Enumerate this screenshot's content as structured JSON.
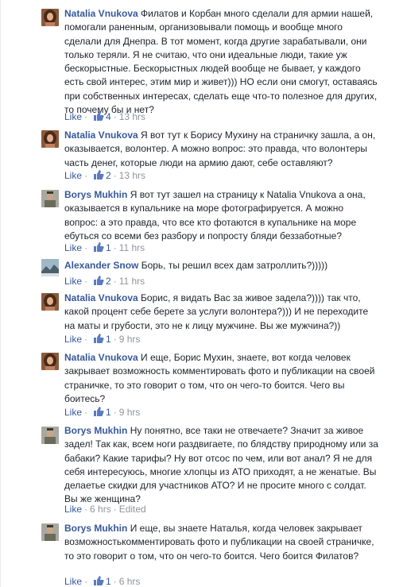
{
  "comments": [
    {
      "author": "Natalia Vnukova",
      "text": "Филатов и Корбан много сделали для армии нашей, помогали раненным, организовывали помощь и вообще много сделали для Днепра. В тот момент, когда другие зарабатывали, они только теряли. Я не считаю, что они идеальные люди, такие уж бескорыстные. Бескорыстных людей вообще не бывает, у каждого есть свой интерес, этим мир и живет))) НО если они смогут, оставаясь при собственных интересах, сделать еще что-то полезное для других, то почему бы и нет?",
      "like_label": "Like",
      "likes": "4",
      "time": "13 hrs",
      "avatar": "female-avatar"
    },
    {
      "author": "Natalia Vnukova",
      "text": "Я вот тут к Борису Мухину на страничку зашла, а он, оказывается, волонтер. А можно вопрос: это правда, что волонтеры часть денег, которые люди на армию дают, себе оставляют?",
      "like_label": "Like",
      "likes": "2",
      "time": "13 hrs",
      "avatar": "female-avatar"
    },
    {
      "author": "Borys Mukhin",
      "text": "Я вот тут зашел на страницу к Natalia Vnukova а она, оказывается в купальнике на море фотографируется. А можно вопрос: а это правда, что все кто фотаются в купальнике на море ебуться со всеми без разбору и попросту бляди беззаботные?",
      "like_label": "Like",
      "likes": "1",
      "time": "11 hrs",
      "avatar": "male-avatar"
    },
    {
      "author": "Alexander Snow",
      "text": "Борь, ты решил всех дам затроллить?)))))",
      "like_label": "Like",
      "likes": "2",
      "time": "11 hrs",
      "avatar": "landscape-avatar"
    },
    {
      "author": "Natalia Vnukova",
      "text": "Борис, я видать Вас за живое задела?)))) так что, какой процент себе берете за услуги волонтера?))) И не переходите на маты и грубости, это не к лицу мужчине. Вы же мужчина?))",
      "like_label": "Like",
      "likes": "1",
      "time": "9 hrs",
      "avatar": "female-avatar"
    },
    {
      "author": "Natalia Vnukova",
      "text": "И еще, Борис Мухин, знаете, вот когда человек закрывает возможность комментировать фото и публикации на своей страничке, то это говорит о том, что он чего-то боится. Чего вы боитесь?",
      "like_label": "Like",
      "likes": "1",
      "time": "9 hrs",
      "avatar": "female-avatar"
    },
    {
      "author": "Borys Mukhin",
      "text": "Ну понятно, все таки не отвечаете? Значит за живое задел! Так как, всем ноги раздвигаете, по блядству природному или за бабаки? Какие тарифы? Ну вот отсос по чем, или вот анал? Я не для себя интересуюсь, многие хлопцы из АТО приходят, а не женатые. Вы делаетье скидки для участников АТО? И не просите много с солдат. Вы же женщина?",
      "like_label": "Like",
      "likes": "",
      "time": "6 hrs",
      "edited": "Edited",
      "avatar": "male-avatar"
    },
    {
      "author": "Borys Mukhin",
      "text": "И еще, вы знаете Наталья, когда человек закрывает возможностькомментировать фото и публикации на своей страничке, то это говорит о том, что он чего-то боится. Чего боится Филатов?",
      "like_label": "Like",
      "likes": "1",
      "time": "6 hrs",
      "avatar": "male-avatar"
    }
  ]
}
